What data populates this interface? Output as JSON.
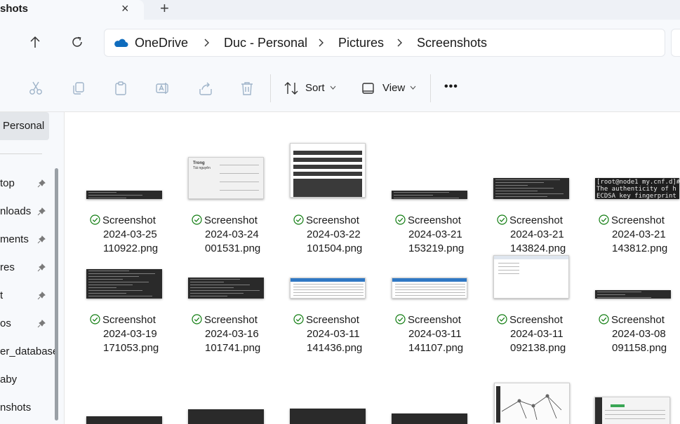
{
  "tab": {
    "title": "shots",
    "close": "×",
    "add": "+"
  },
  "address": {
    "crumbs": [
      "OneDrive",
      "Duc - Personal",
      "Pictures",
      "Screenshots"
    ]
  },
  "toolbar": {
    "sort_label": "Sort",
    "view_label": "View",
    "more_label": "•••"
  },
  "sidebar": {
    "active_label": "Personal",
    "items": [
      {
        "label": "top",
        "pinned": true
      },
      {
        "label": "nloads",
        "pinned": true
      },
      {
        "label": "ments",
        "pinned": true
      },
      {
        "label": "res",
        "pinned": true
      },
      {
        "label": "t",
        "pinned": true
      },
      {
        "label": "os",
        "pinned": true
      },
      {
        "label": "er_database",
        "pinned": false
      },
      {
        "label": "aby",
        "pinned": false
      },
      {
        "label": "nshots",
        "pinned": false
      }
    ]
  },
  "files": [
    {
      "line1": "Screenshot",
      "line2": "2024-03-25",
      "line3": "110922.png",
      "thumb": "dark-strip"
    },
    {
      "line1": "Screenshot",
      "line2": "2024-03-24",
      "line3": "001531.png",
      "thumb": "light-doc",
      "thumb_title": "Trong",
      "thumb_subtitle": "Tài nguyên"
    },
    {
      "line1": "Screenshot",
      "line2": "2024-03-22",
      "line3": "101504.png",
      "thumb": "form"
    },
    {
      "line1": "Screenshot",
      "line2": "2024-03-21",
      "line3": "153219.png",
      "thumb": "dark-strip"
    },
    {
      "line1": "Screenshot",
      "line2": "2024-03-21",
      "line3": "143824.png",
      "thumb": "terminal"
    },
    {
      "line1": "Screenshot",
      "line2": "2024-03-21",
      "line3": "143812.png",
      "thumb": "terminal-text",
      "thumb_lines": [
        "[root@node1 my.cnf.d]#",
        "The authenticity of h",
        "ECDSA key fingerprint"
      ]
    },
    {
      "line1": "Screenshot",
      "line2": "2024-03-19",
      "line3": "171053.png",
      "thumb": "terminal"
    },
    {
      "line1": "Screenshot",
      "line2": "2024-03-16",
      "line3": "101741.png",
      "thumb": "terminal"
    },
    {
      "line1": "Screenshot",
      "line2": "2024-03-11",
      "line3": "141436.png",
      "thumb": "table-light"
    },
    {
      "line1": "Screenshot",
      "line2": "2024-03-11",
      "line3": "141107.png",
      "thumb": "table-light"
    },
    {
      "line1": "Screenshot",
      "line2": "2024-03-11",
      "line3": "092138.png",
      "thumb": "dialog"
    },
    {
      "line1": "Screenshot",
      "line2": "2024-03-08",
      "line3": "091158.png",
      "thumb": "dark-strip"
    }
  ],
  "colors": {
    "accent": "#0067c0",
    "sync_green": "#107c10",
    "onedrive_blue": "#0f6cbd"
  }
}
